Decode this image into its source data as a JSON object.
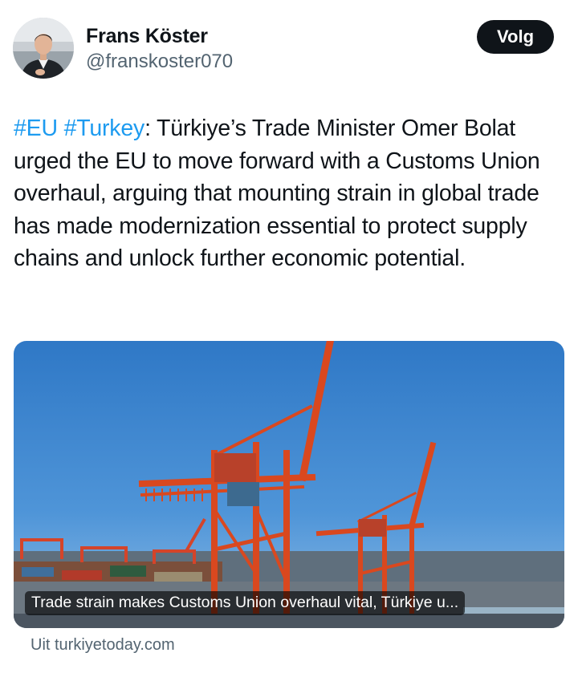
{
  "author": {
    "display_name": "Frans Köster",
    "handle": "@franskoster070",
    "follow_label": "Volg"
  },
  "tweet": {
    "hashtag_1": "#EU",
    "hashtag_2": "#Turkey",
    "body": ": Türkiye’s Trade Minister Omer Bolat urged the EU to move forward with a Customs Union overhaul, arguing that mounting strain in global trade has made modernization essential to protect supply chains and unlock further economic potential."
  },
  "link_card": {
    "title": "Trade strain makes Customs Union overhaul vital, Türkiye u...",
    "source": "Uit turkiyetoday.com",
    "image_icon": "port-cranes-photo"
  },
  "colors": {
    "text": "#0f1419",
    "secondary": "#536471",
    "link": "#1d9bf0",
    "follow_button": "#0f1419"
  }
}
